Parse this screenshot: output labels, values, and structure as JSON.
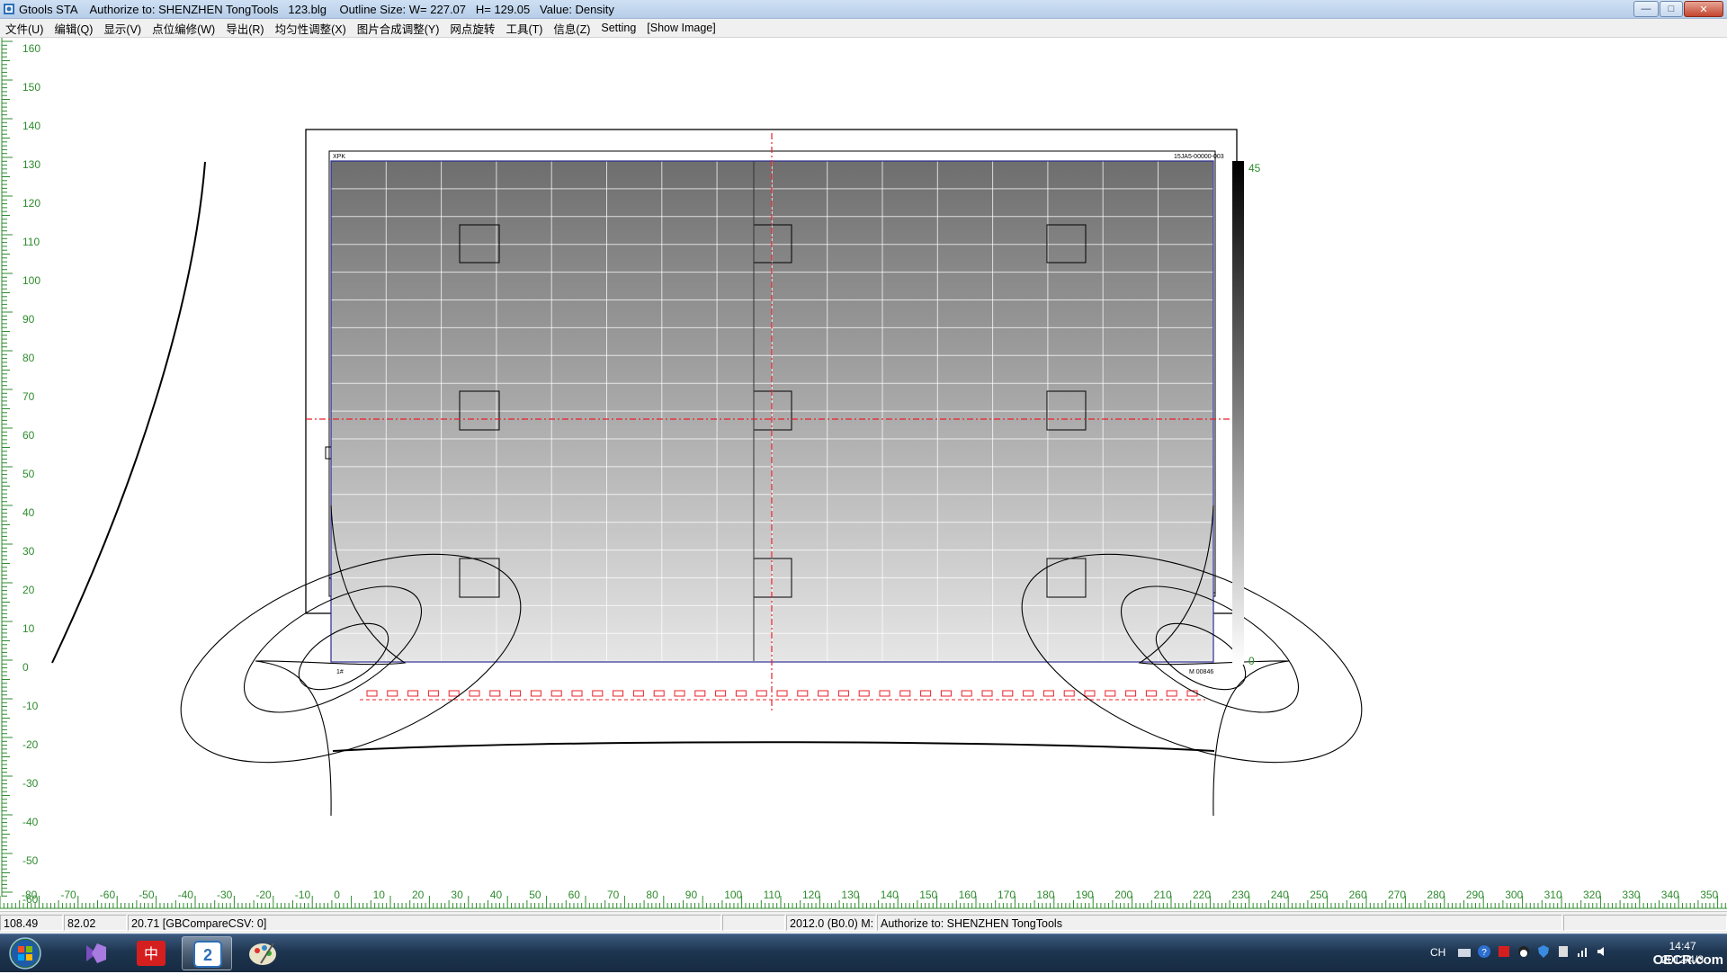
{
  "window": {
    "title": "Gtools STA    Authorize to: SHENZHEN TongTools   123.blg    Outline Size: W= 227.07   H= 129.05   Value: Density",
    "minimize_label": "—",
    "maximize_label": "□",
    "close_label": "✕"
  },
  "menu": [
    "文件(U)",
    "编辑(Q)",
    "显示(V)",
    "点位编修(W)",
    "导出(R)",
    "均匀性调整(X)",
    "图片合成调整(Y)",
    "网点旋转",
    "工具(T)",
    "信息(Z)",
    "Setting",
    "[Show Image]"
  ],
  "ruler": {
    "y_labels": [
      "160",
      "150",
      "140",
      "130",
      "120",
      "110",
      "100",
      "90",
      "80",
      "70",
      "60",
      "50",
      "40",
      "30",
      "20",
      "10",
      "0",
      "-10",
      "-20",
      "-30",
      "-40",
      "-50",
      "-60"
    ],
    "x_labels": [
      "-80",
      "-70",
      "-60",
      "-50",
      "-40",
      "-30",
      "-20",
      "-10",
      "0",
      "10",
      "20",
      "30",
      "40",
      "50",
      "60",
      "70",
      "80",
      "90",
      "100",
      "110",
      "120",
      "130",
      "140",
      "150",
      "160",
      "170",
      "180",
      "190",
      "200",
      "210",
      "220",
      "230",
      "240",
      "250",
      "260",
      "270",
      "280",
      "290",
      "300",
      "310",
      "320",
      "330",
      "340",
      "350"
    ],
    "color": "#2e8b2e"
  },
  "plate": {
    "top_left_label": "XPK",
    "top_right_label": "15JA5-00000-003",
    "bottom_left_label": "1#",
    "bottom_right_label": "M 00846",
    "gradient_top": "#6e6e6e",
    "gradient_bottom": "#e6e6e6"
  },
  "density_scale": {
    "max_label": "45",
    "min_label": "0"
  },
  "status": {
    "x": "108.49",
    "y": "82.02",
    "value": "20.71 [GBCompareCSV: 0]",
    "empty": "",
    "info": "2012.0 (B0.0) M:",
    "authorize": "Authorize to: SHENZHEN TongTools"
  },
  "taskbar": {
    "lang": "CH",
    "time": "14:47",
    "date": "2012/4/3",
    "watermark": "OECR.com"
  },
  "icons": [
    "app-icon",
    "start-orb-icon",
    "visual-studio-icon",
    "pdf-reader-icon",
    "gtools-icon",
    "paint-icon",
    "help-icon",
    "network-icon",
    "volume-icon",
    "shield-icon"
  ]
}
